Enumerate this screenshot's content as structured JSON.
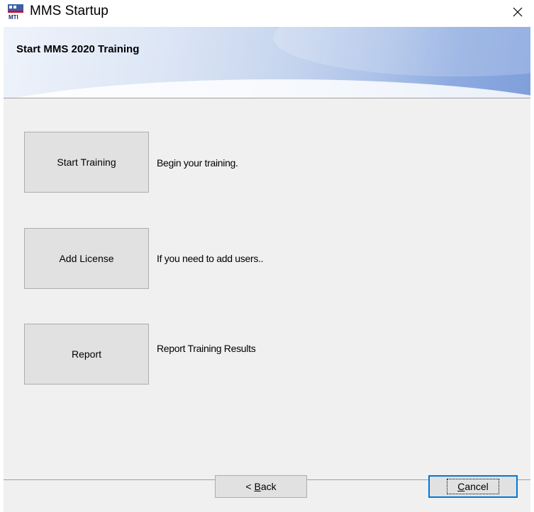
{
  "window": {
    "title": "MMS Startup",
    "close_glyph": "×",
    "icon": "mms-app-icon"
  },
  "banner": {
    "title": "Start MMS 2020 Training"
  },
  "options": [
    {
      "button_label": "Start Training",
      "description": "Begin your training."
    },
    {
      "button_label": "Add License",
      "description": "If you need to add users.."
    },
    {
      "button_label": "Report",
      "description": "Report Training Results"
    }
  ],
  "footer": {
    "back_prefix": "< ",
    "back_mnemonic": "B",
    "back_rest": "ack",
    "cancel_mnemonic": "C",
    "cancel_rest": "ancel"
  },
  "colors": {
    "banner_accent": "#7f9fdc",
    "default_button_border": "#0078d7",
    "panel_background": "#f0f0f0"
  }
}
